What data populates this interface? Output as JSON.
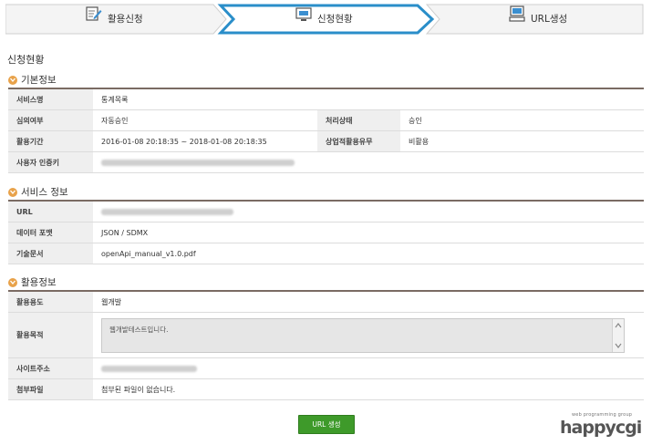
{
  "steps": [
    {
      "label": "활용신청",
      "icon": "edit-document-icon"
    },
    {
      "label": "신청현황",
      "icon": "monitor-icon"
    },
    {
      "label": "URL생성",
      "icon": "computer-icon"
    }
  ],
  "page_title": "신청현황",
  "sections": {
    "basic": {
      "title": "기본정보",
      "service_name_label": "서비스명",
      "service_name_value": "통계목록",
      "review_label": "심의여부",
      "review_value": "자동승인",
      "process_label": "처리상태",
      "process_value": "승인",
      "period_label": "활용기간",
      "period_value": "2016-01-08 20:18:35 ~ 2018-01-08 20:18:35",
      "commercial_label": "상업적활용유무",
      "commercial_value": "비활용",
      "auth_key_label": "사용자 인증키"
    },
    "service": {
      "title": "서비스 정보",
      "url_label": "URL",
      "format_label": "데이터 포맷",
      "format_value": "JSON / SDMX",
      "doc_label": "기술문서",
      "doc_value": "openApi_manual_v1.0.pdf"
    },
    "usage": {
      "title": "활용정보",
      "purpose_label": "활용용도",
      "purpose_value": "웹개발",
      "goal_label": "활용목적",
      "goal_value": "웹개발테스트입니다.",
      "site_label": "사이트주소",
      "attach_label": "첨부파일",
      "attach_value": "첨부된 파일이 없습니다."
    }
  },
  "button_label": "URL 생성",
  "logo": {
    "tagline": "web programming group",
    "name": "happycgi"
  },
  "colors": {
    "active_step": "#2a8ec9",
    "button": "#3e9a2a",
    "section_icon": "#e8a24a",
    "table_border": "#7a6b63"
  }
}
